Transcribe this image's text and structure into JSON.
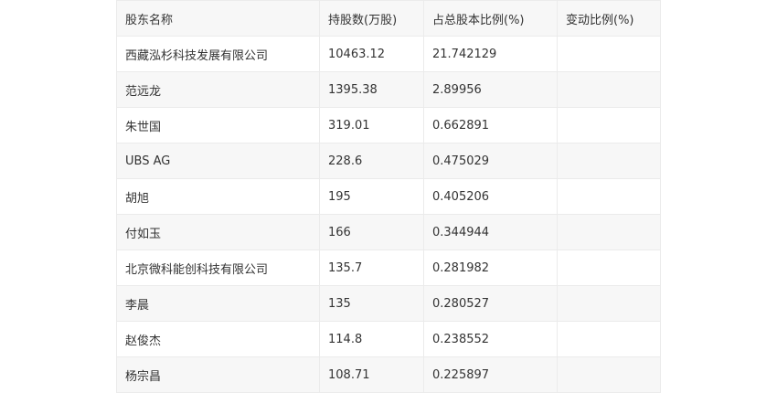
{
  "table": {
    "headers": [
      "股东名称",
      "持股数(万股)",
      "占总股本比例(%)",
      "变动比例(%)"
    ],
    "rows": [
      [
        "西藏泓杉科技发展有限公司",
        "10463.12",
        "21.742129",
        ""
      ],
      [
        "范远龙",
        "1395.38",
        "2.89956",
        ""
      ],
      [
        "朱世国",
        "319.01",
        "0.662891",
        ""
      ],
      [
        "UBS AG",
        "228.6",
        "0.475029",
        ""
      ],
      [
        "胡旭",
        "195",
        "0.405206",
        ""
      ],
      [
        "付如玉",
        "166",
        "0.344944",
        ""
      ],
      [
        "北京微科能创科技有限公司",
        "135.7",
        "0.281982",
        ""
      ],
      [
        "李晨",
        "135",
        "0.280527",
        ""
      ],
      [
        "赵俊杰",
        "114.8",
        "0.238552",
        ""
      ],
      [
        "杨宗昌",
        "108.71",
        "0.225897",
        ""
      ]
    ]
  }
}
